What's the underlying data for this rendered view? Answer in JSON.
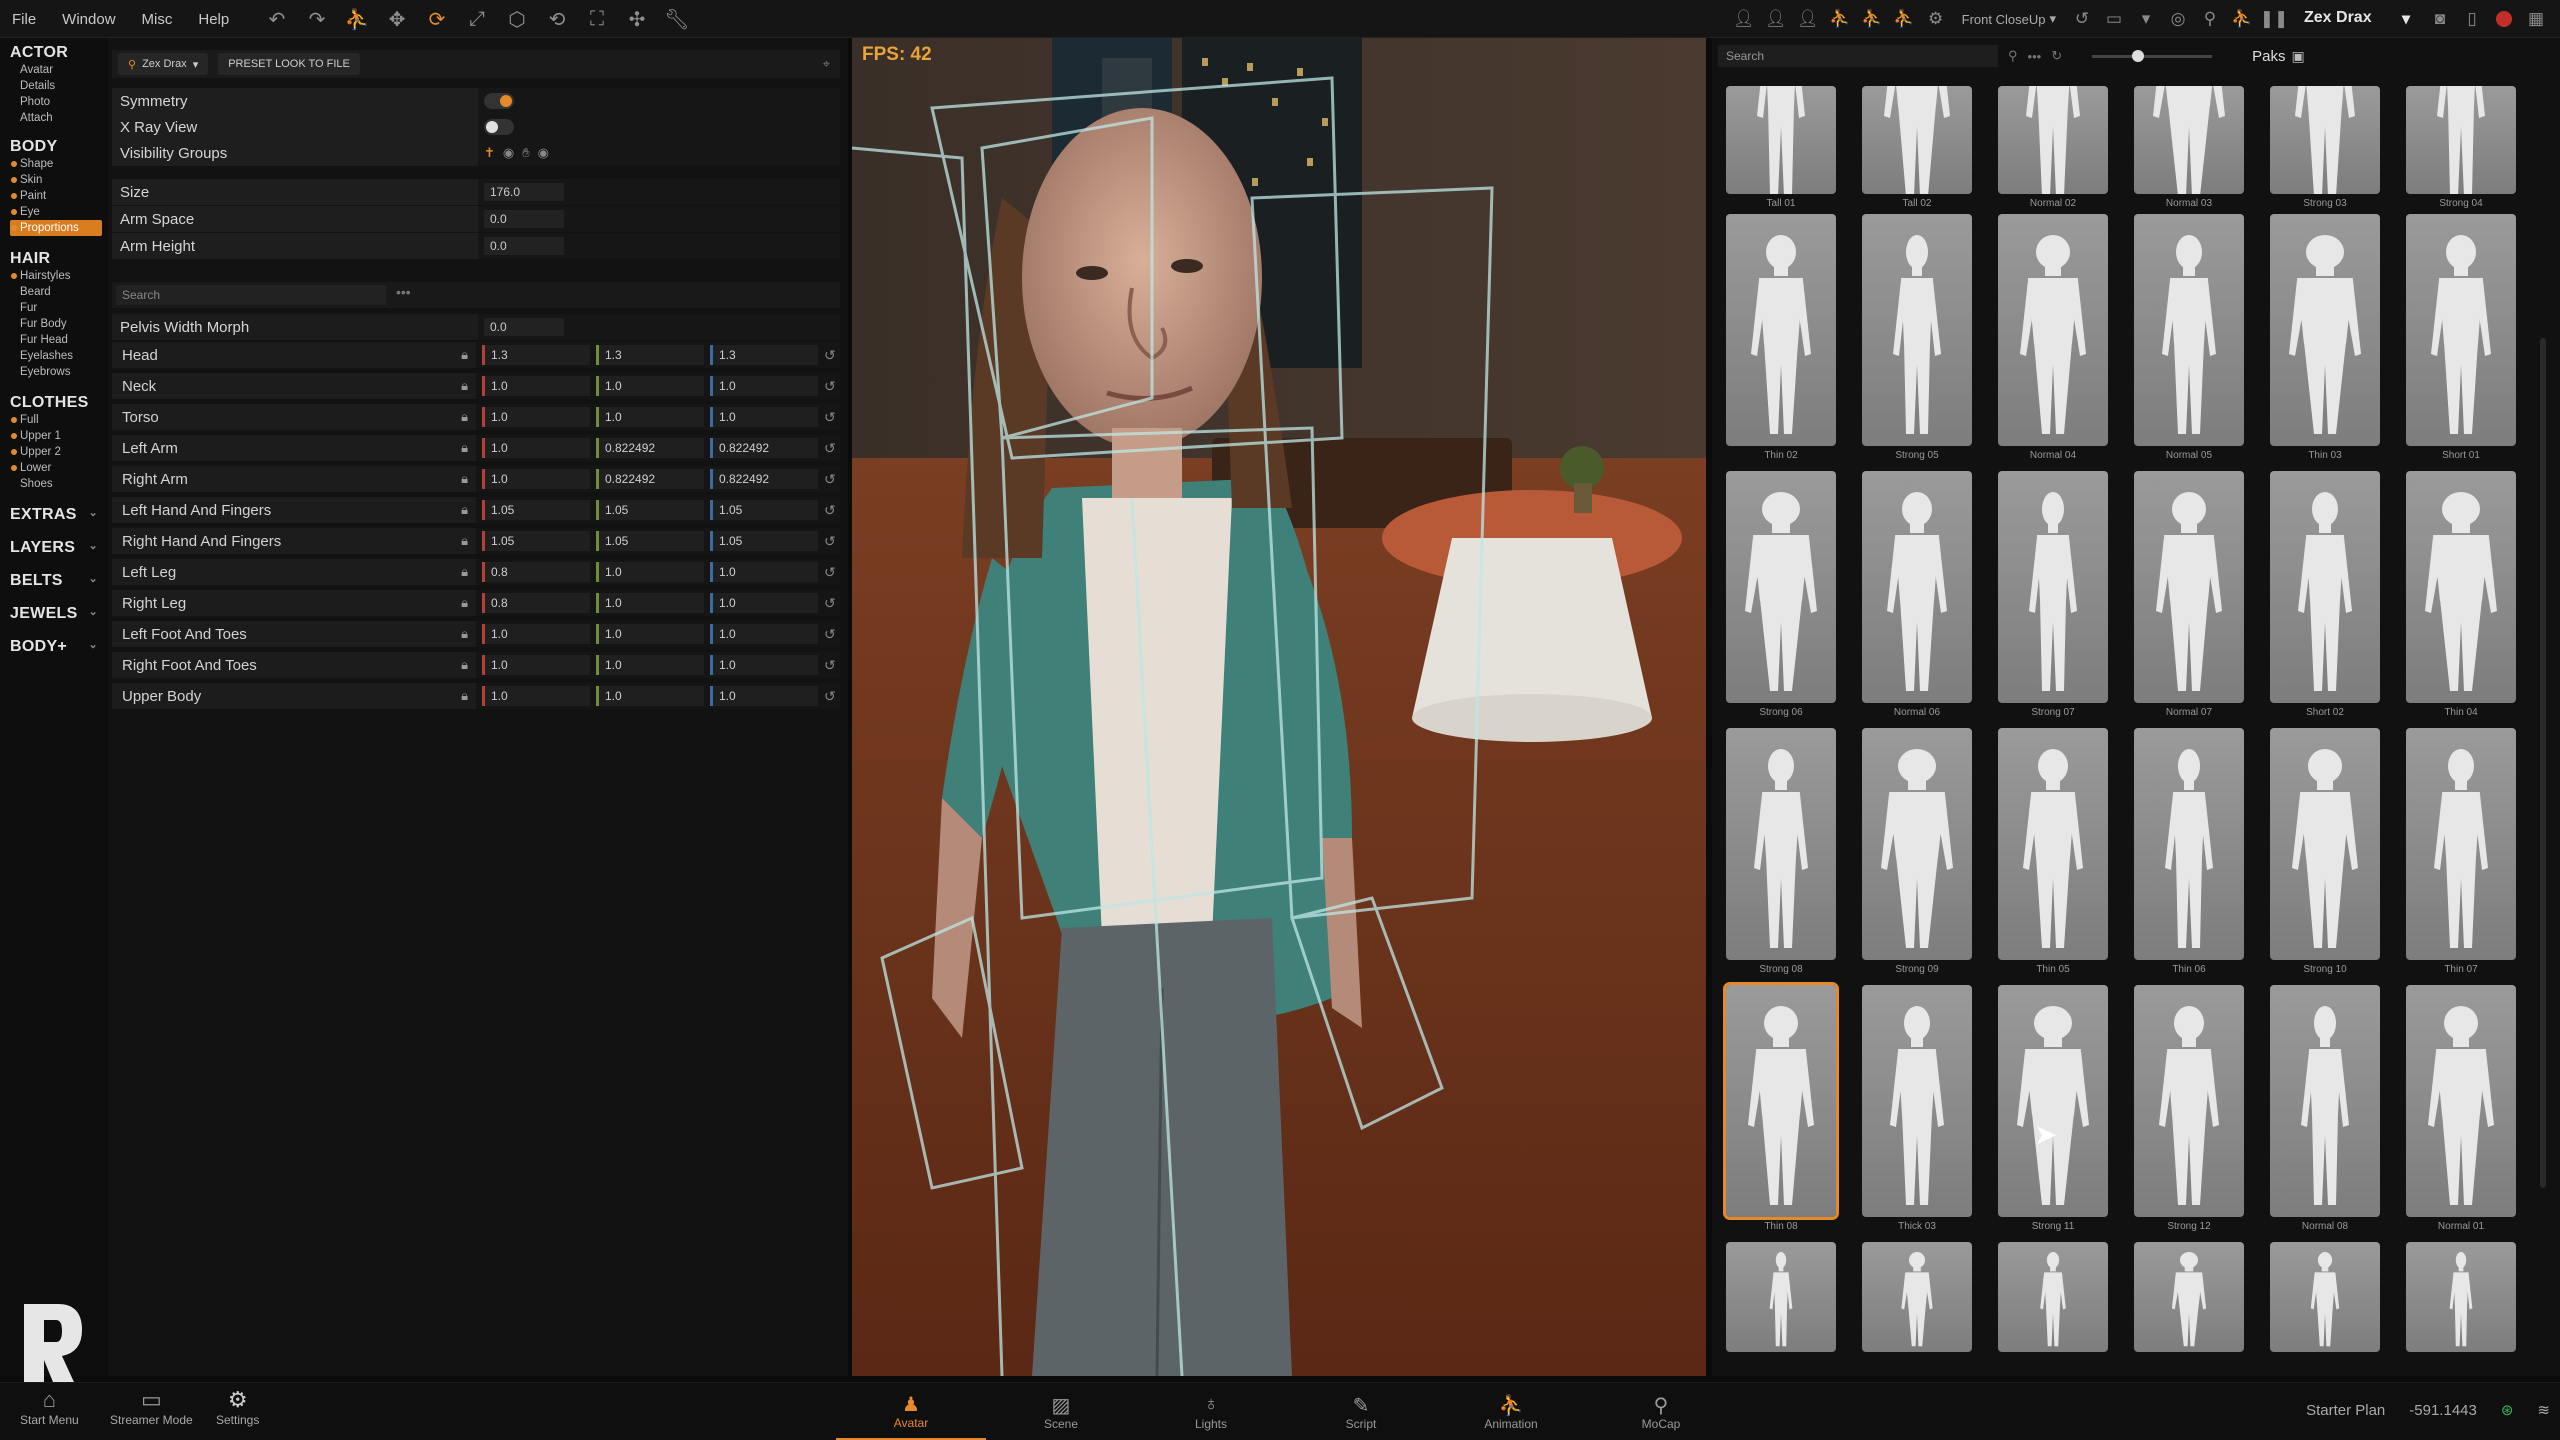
{
  "menu": [
    "File",
    "Window",
    "Misc",
    "Help"
  ],
  "camera": {
    "label": "Front CloseUp"
  },
  "actor_name": "Zex Drax",
  "sidebar": {
    "sections": [
      {
        "title": "ACTOR",
        "items": [
          "Avatar",
          "Details",
          "Photo",
          "Attach"
        ]
      },
      {
        "title": "BODY",
        "items": [
          "Shape",
          "Skin",
          "Paint",
          "Eye",
          "Proportions"
        ]
      },
      {
        "title": "HAIR",
        "items": [
          "Hairstyles",
          "Beard",
          "Fur",
          "Fur Body",
          "Fur Head",
          "Eyelashes",
          "Eyebrows"
        ]
      },
      {
        "title": "CLOTHES",
        "items": [
          "Full",
          "Upper 1",
          "Upper 2",
          "Lower",
          "Shoes"
        ]
      }
    ],
    "collapsed": [
      "EXTRAS",
      "LAYERS",
      "BELTS",
      "JEWELS",
      "BODY+"
    ]
  },
  "props": {
    "actor_pill": "Zex Drax",
    "preset_button": "PRESET LOOK TO FILE",
    "symmetry_label": "Symmetry",
    "xray_label": "X Ray View",
    "visibility_label": "Visibility Groups",
    "size_label": "Size",
    "size_value": "176.0",
    "arm_space_label": "Arm Space",
    "arm_space_value": "0.0",
    "arm_height_label": "Arm Height",
    "arm_height_value": "0.0",
    "search_placeholder": "Search",
    "pelvis_label": "Pelvis Width Morph",
    "pelvis_value": "0.0"
  },
  "morphs": [
    {
      "name": "Head",
      "x": "1.3",
      "y": "1.3",
      "z": "1.3"
    },
    {
      "name": "Neck",
      "x": "1.0",
      "y": "1.0",
      "z": "1.0"
    },
    {
      "name": "Torso",
      "x": "1.0",
      "y": "1.0",
      "z": "1.0"
    },
    {
      "name": "Left Arm",
      "x": "1.0",
      "y": "0.822492",
      "z": "0.822492"
    },
    {
      "name": "Right Arm",
      "x": "1.0",
      "y": "0.822492",
      "z": "0.822492"
    },
    {
      "name": "Left Hand And Fingers",
      "x": "1.05",
      "y": "1.05",
      "z": "1.05"
    },
    {
      "name": "Right Hand And Fingers",
      "x": "1.05",
      "y": "1.05",
      "z": "1.05"
    },
    {
      "name": "Left Leg",
      "x": "0.8",
      "y": "1.0",
      "z": "1.0"
    },
    {
      "name": "Right Leg",
      "x": "0.8",
      "y": "1.0",
      "z": "1.0"
    },
    {
      "name": "Left Foot And Toes",
      "x": "1.0",
      "y": "1.0",
      "z": "1.0"
    },
    {
      "name": "Right Foot And Toes",
      "x": "1.0",
      "y": "1.0",
      "z": "1.0"
    },
    {
      "name": "Upper Body",
      "x": "1.0",
      "y": "1.0",
      "z": "1.0"
    }
  ],
  "viewport": {
    "fps": "FPS: 42"
  },
  "browser": {
    "search_placeholder": "Search",
    "paks_label": "Paks",
    "rows": [
      [
        "Tall 01",
        "Tall 02",
        "Normal 02",
        "Normal 03",
        "Strong 03",
        "Strong 04"
      ],
      [
        "Thin 02",
        "Strong 05",
        "Normal 04",
        "Normal 05",
        "Thin 03",
        "Short 01"
      ],
      [
        "Strong 06",
        "Normal 06",
        "Strong 07",
        "Normal 07",
        "Short 02",
        "Thin 04"
      ],
      [
        "Strong 08",
        "Strong 09",
        "Thin 05",
        "Thin 06",
        "Strong 10",
        "Thin 07"
      ],
      [
        "Thin 08",
        "Thick 03",
        "Strong 11",
        "Strong 12",
        "Normal 08",
        "Normal 01"
      ],
      [
        "",
        "",
        "",
        "",
        "",
        ""
      ]
    ],
    "selected": "Thin 08"
  },
  "bottom": {
    "start_menu": "Start Menu",
    "streamer_mode": "Streamer Mode",
    "settings": "Settings",
    "tabs": [
      "Avatar",
      "Scene",
      "Lights",
      "Script",
      "Animation",
      "MoCap"
    ],
    "active_tab": "Avatar",
    "plan": "Starter Plan",
    "coord": "-591.1443"
  },
  "colors": {
    "accent": "#e48a2a",
    "fps": "#e8a43a"
  }
}
